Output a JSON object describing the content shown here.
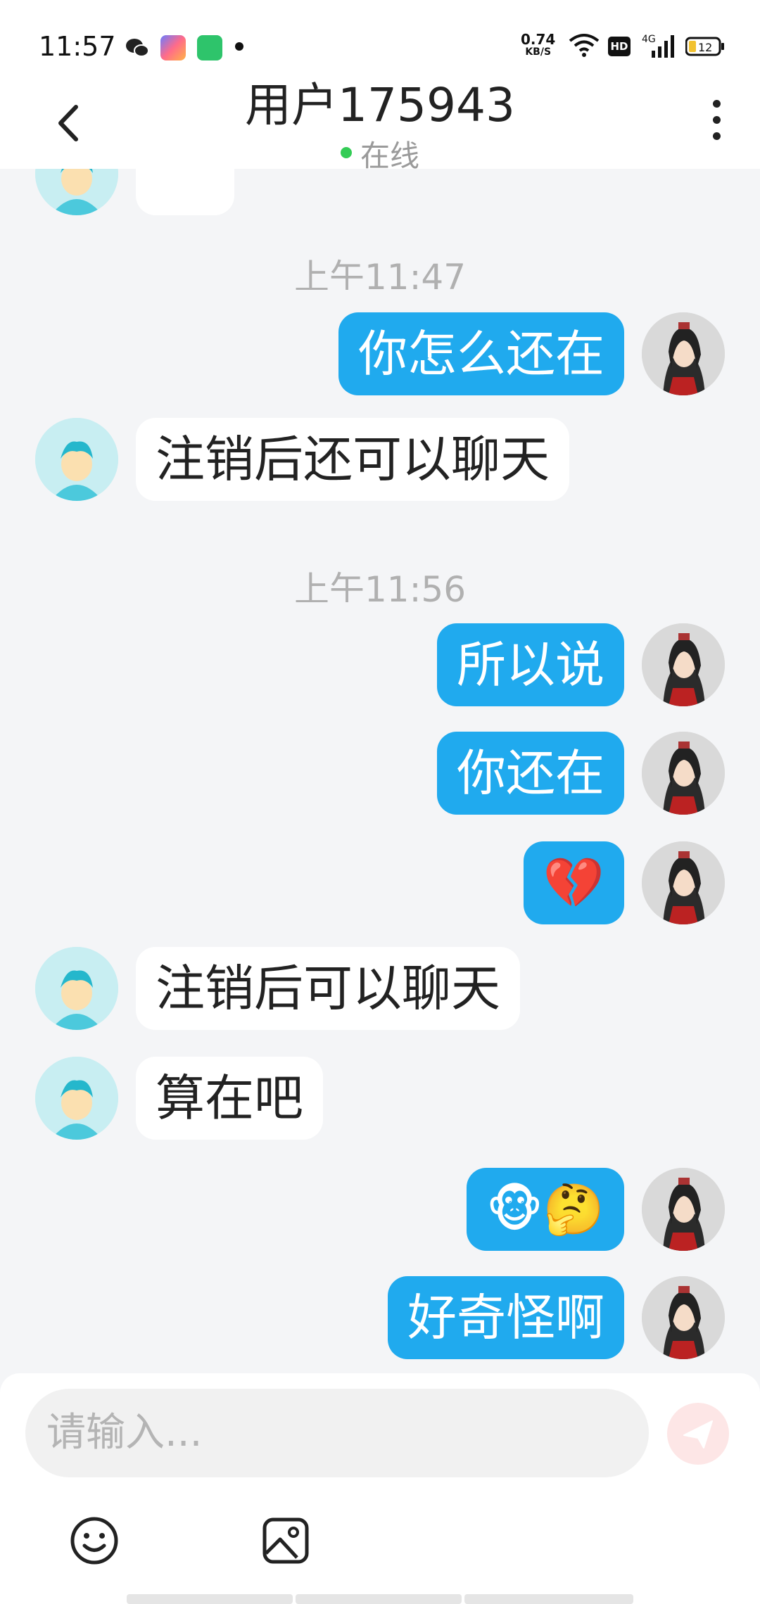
{
  "status_bar": {
    "time": "11:57",
    "net_speed": "0.74",
    "net_speed_unit": "KB/S",
    "battery": "12",
    "network": "4G",
    "hd": "HD",
    "icons": [
      "wechat-icon",
      "app-icon",
      "shop-icon",
      "wifi-icon",
      "signal-icon",
      "battery-icon"
    ]
  },
  "header": {
    "title": "用户175943",
    "status": "在线"
  },
  "messages": [
    {
      "type": "timestamp",
      "text": "上午11:47"
    },
    {
      "type": "out",
      "text": "你怎么还在"
    },
    {
      "type": "in",
      "text": "注销后还可以聊天"
    },
    {
      "type": "timestamp",
      "text": "上午11:56"
    },
    {
      "type": "out",
      "text": "所以说"
    },
    {
      "type": "out",
      "text": "你还在"
    },
    {
      "type": "out",
      "text": "💔"
    },
    {
      "type": "in",
      "text": "注销后可以聊天"
    },
    {
      "type": "in",
      "text": "算在吧"
    },
    {
      "type": "out",
      "text": "🐵🤔"
    },
    {
      "type": "out",
      "text": "好奇怪啊"
    }
  ],
  "input": {
    "placeholder": "请输入..."
  },
  "colors": {
    "outgoing_bubble": "#20aaee",
    "incoming_bubble": "#ffffff",
    "background": "#f4f5f7",
    "online_dot": "#33cc55",
    "send_button": "#fde6e6"
  }
}
